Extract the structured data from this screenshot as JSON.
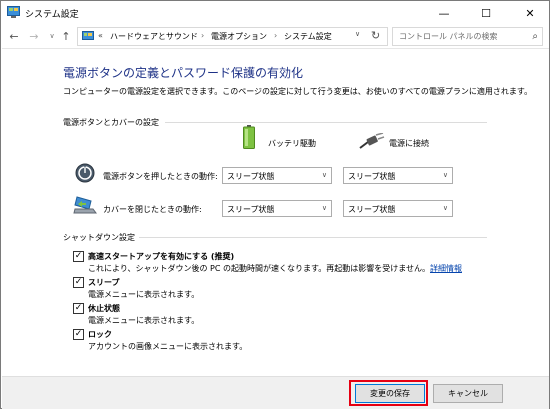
{
  "window": {
    "title": "システム設定",
    "controls": {
      "minimize": "—",
      "maximize": "☐",
      "close": "✕"
    }
  },
  "nav": {
    "back": "←",
    "forward": "→",
    "dropdown": "∨",
    "up": "↑",
    "breadcrumb_prefix": "«",
    "breadcrumbs": [
      "ハードウェアとサウンド",
      "電源オプション",
      "システム設定"
    ],
    "separator": "›",
    "address_dropdown": "∨",
    "refresh": "↻",
    "search_placeholder": "コントロール パネルの検索",
    "search_icon": "⌕"
  },
  "main": {
    "heading": "電源ボタンの定義とパスワード保護の有効化",
    "description": "コンピューターの電源設定を選択できます。このページの設定に対して行う変更は、お使いのすべての電源プランに適用されます。",
    "power_group": {
      "title": "電源ボタンとカバーの設定",
      "col_battery": "バッテリ駆動",
      "col_plugged": "電源に接続",
      "rows": [
        {
          "label": "電源ボタンを押したときの動作:",
          "battery": "スリープ状態",
          "plugged": "スリープ状態"
        },
        {
          "label": "カバーを閉じたときの動作:",
          "battery": "スリープ状態",
          "plugged": "スリープ状態"
        }
      ],
      "arrow": "∨"
    },
    "shutdown_group": {
      "title": "シャットダウン設定",
      "check_mark": "✓",
      "items": [
        {
          "label": "高速スタートアップを有効にする (推奨)",
          "desc": "これにより、シャットダウン後の PC の起動時間が速くなります。再起動は影響を受けません。",
          "link": "詳細情報",
          "checked": true
        },
        {
          "label": "スリープ",
          "desc": "電源メニューに表示されます。",
          "checked": true
        },
        {
          "label": "休止状態",
          "desc": "電源メニューに表示されます。",
          "checked": true
        },
        {
          "label": "ロック",
          "desc": "アカウントの画像メニューに表示されます。",
          "checked": true
        }
      ]
    }
  },
  "footer": {
    "save_label": "変更の保存",
    "cancel_label": "キャンセル"
  },
  "colors": {
    "heading": "#1e3287",
    "link": "#0645ad",
    "highlight": "#e60012",
    "footer_bg": "#f0f0f0"
  }
}
